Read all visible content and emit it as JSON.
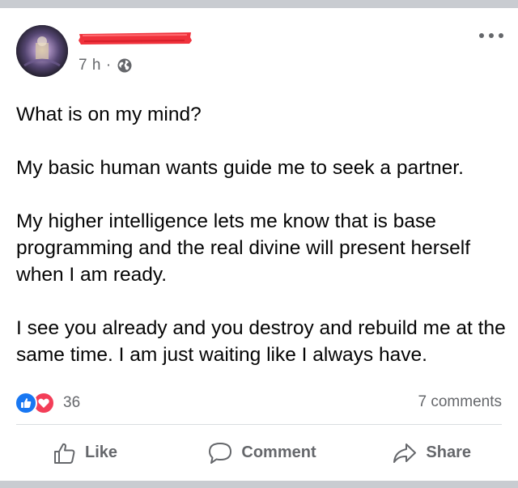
{
  "post": {
    "time": "7 h",
    "separator": "·",
    "privacy_icon": "globe-icon",
    "paragraphs": [
      "What is on my mind?",
      "My basic human wants guide me to seek a partner.",
      "My higher intelligence lets me know that is base programming and the real divine will present herself when I am ready.",
      "I see you already and you destroy and rebuild me at the same time. I am just waiting like I always have."
    ]
  },
  "reactions": {
    "icons": [
      "like-reaction-icon",
      "love-reaction-icon"
    ],
    "count": "36"
  },
  "comments": {
    "label": "7 comments"
  },
  "actions": {
    "like_label": "Like",
    "comment_label": "Comment",
    "share_label": "Share"
  },
  "colors": {
    "like_blue": "#1877f2",
    "love_red": "#f33e58",
    "secondary_text": "#65676b",
    "redaction": "#f0323c"
  }
}
